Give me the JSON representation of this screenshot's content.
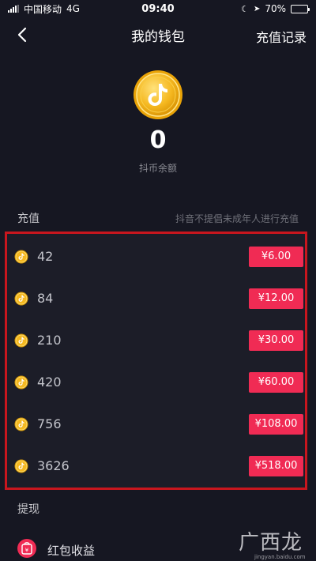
{
  "status_bar": {
    "carrier": "中国移动",
    "network": "4G",
    "time": "09:40",
    "battery": "70%",
    "battery_level": 0.7
  },
  "nav": {
    "title": "我的钱包",
    "right_link": "充值记录"
  },
  "wallet": {
    "balance": "0",
    "balance_label": "抖币余额"
  },
  "recharge": {
    "title": "充值",
    "note": "抖音不提倡未成年人进行充值",
    "packages": [
      {
        "amount": "42",
        "price": "¥6.00"
      },
      {
        "amount": "84",
        "price": "¥12.00"
      },
      {
        "amount": "210",
        "price": "¥30.00"
      },
      {
        "amount": "420",
        "price": "¥60.00"
      },
      {
        "amount": "756",
        "price": "¥108.00"
      },
      {
        "amount": "3626",
        "price": "¥518.00"
      }
    ]
  },
  "withdraw": {
    "title": "提现",
    "items": [
      {
        "label": "红包收益"
      }
    ]
  },
  "watermark": {
    "main": "广西龙网",
    "sub": "jingyan.baidu.com"
  },
  "colors": {
    "background": "#161722",
    "accent": "#f02b54",
    "highlight_border": "#c8161e",
    "coin_gold": "#f5b820"
  }
}
